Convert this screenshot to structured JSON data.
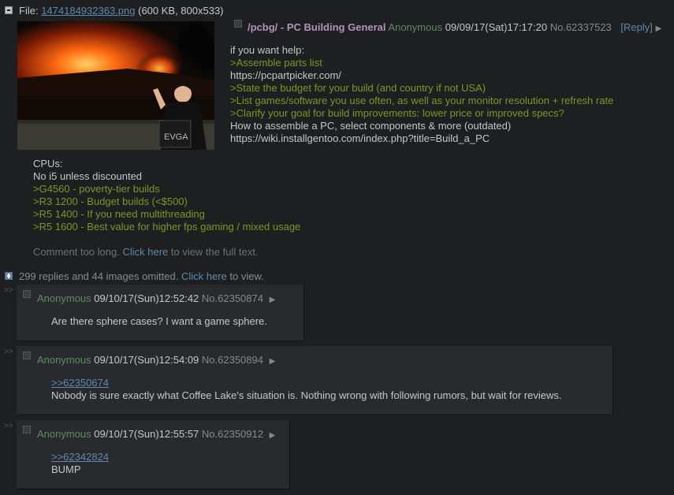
{
  "op": {
    "file_label": "File:",
    "file_name": "1474184932363.png",
    "file_meta": "(600 KB, 800x533)",
    "subject": "/pcbg/ - PC Building General",
    "name": "Anonymous",
    "date": "09/09/17(Sat)17:17:20",
    "number": "No.62337523",
    "reply_link": "[Reply]",
    "arrow": "▶",
    "lines": [
      {
        "text": "if you want help:",
        "style": "normal"
      },
      {
        "text": ">Assemble parts list",
        "style": "green"
      },
      {
        "text": "https://pcpartpicker.com/",
        "style": "normal"
      },
      {
        "text": ">State the budget for your build (and country if not USA)",
        "style": "green"
      },
      {
        "text": ">List games/software you use often, as well as your monitor resolution + refresh rate",
        "style": "green"
      },
      {
        "text": ">Clarify your goal for build improvements: lower price or improved specs?",
        "style": "green"
      },
      {
        "text": "How to assemble a PC, select components & more (outdated)",
        "style": "normal"
      },
      {
        "text": "https://wiki.installgentoo.com/index.php?title=Build_a_PC",
        "style": "normal"
      }
    ],
    "lines2": [
      {
        "text": "CPUs:",
        "style": "normal"
      },
      {
        "text": "No i5 unless discounted",
        "style": "normal"
      },
      {
        "text": ">G4560 - poverty-tier builds",
        "style": "green"
      },
      {
        "text": ">R3 1200 - Budget builds (<$500)",
        "style": "green"
      },
      {
        "text": ">R5 1400 - If you need multithreading",
        "style": "green"
      },
      {
        "text": ">R5 1600 - Best value for higher fps gaming / mixed usage",
        "style": "green"
      }
    ],
    "too_long_pre": "Comment too long. ",
    "too_long_link": "Click here",
    "too_long_post": " to view the full text."
  },
  "omitted": {
    "text": "299 replies and 44 images omitted. ",
    "link": "Click here",
    "post": " to view."
  },
  "replies": [
    {
      "marker": ">>",
      "name": "Anonymous",
      "date": "09/10/17(Sun)12:52:42",
      "number": "No.62350874",
      "arrow": "▶",
      "quote": "",
      "body": "Are there sphere cases? I want a game sphere."
    },
    {
      "marker": ">>",
      "name": "Anonymous",
      "date": "09/10/17(Sun)12:54:09",
      "number": "No.62350894",
      "arrow": "▶",
      "quote": ">>62350674",
      "body": "Nobody is sure exactly what Coffee Lake's situation is. Nothing wrong with following rumors, but wait for reviews."
    },
    {
      "marker": ">>",
      "name": "Anonymous",
      "date": "09/10/17(Sun)12:55:57",
      "number": "No.62350912",
      "arrow": "▶",
      "quote": ">>62342824",
      "body": "BUMP"
    }
  ],
  "thumbnail": {
    "overlay_text": "EVGA"
  },
  "colors": {
    "background": "#1d1f21",
    "post": "#282a2e",
    "greentext": "#789922",
    "name": "#5f8b6a",
    "link": "#5f89ac"
  }
}
